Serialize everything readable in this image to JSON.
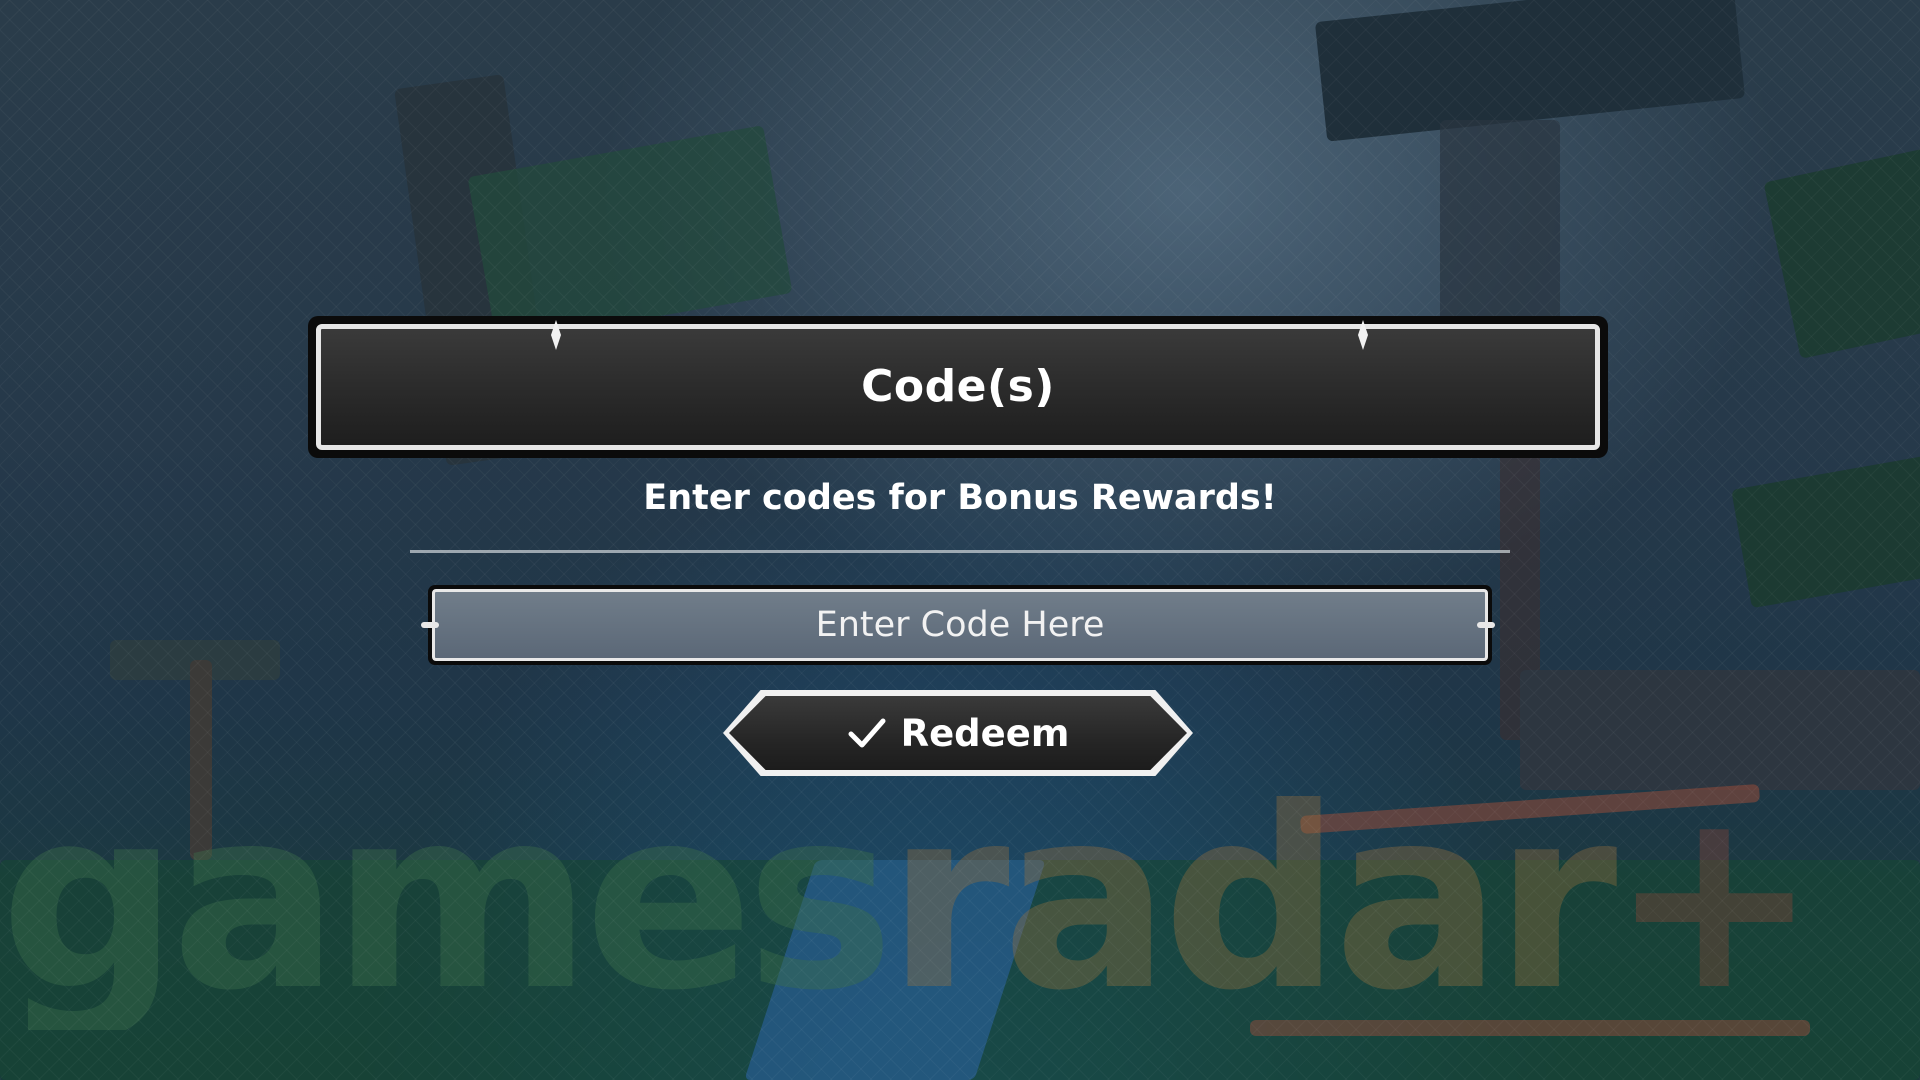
{
  "dialog": {
    "title": "Code(s)",
    "subtitle": "Enter codes for Bonus Rewards!",
    "code_input": {
      "placeholder": "Enter Code Here",
      "value": ""
    },
    "redeem_button": {
      "label": "Redeem",
      "icon": "check-icon"
    }
  },
  "watermark": {
    "games": "games",
    "radar": "radar",
    "plus": "+"
  },
  "colors": {
    "panel_dark": "#2a2a2a",
    "panel_border": "#e6e6e6",
    "input_fill": "#7a8aa0",
    "text": "#ffffff"
  }
}
